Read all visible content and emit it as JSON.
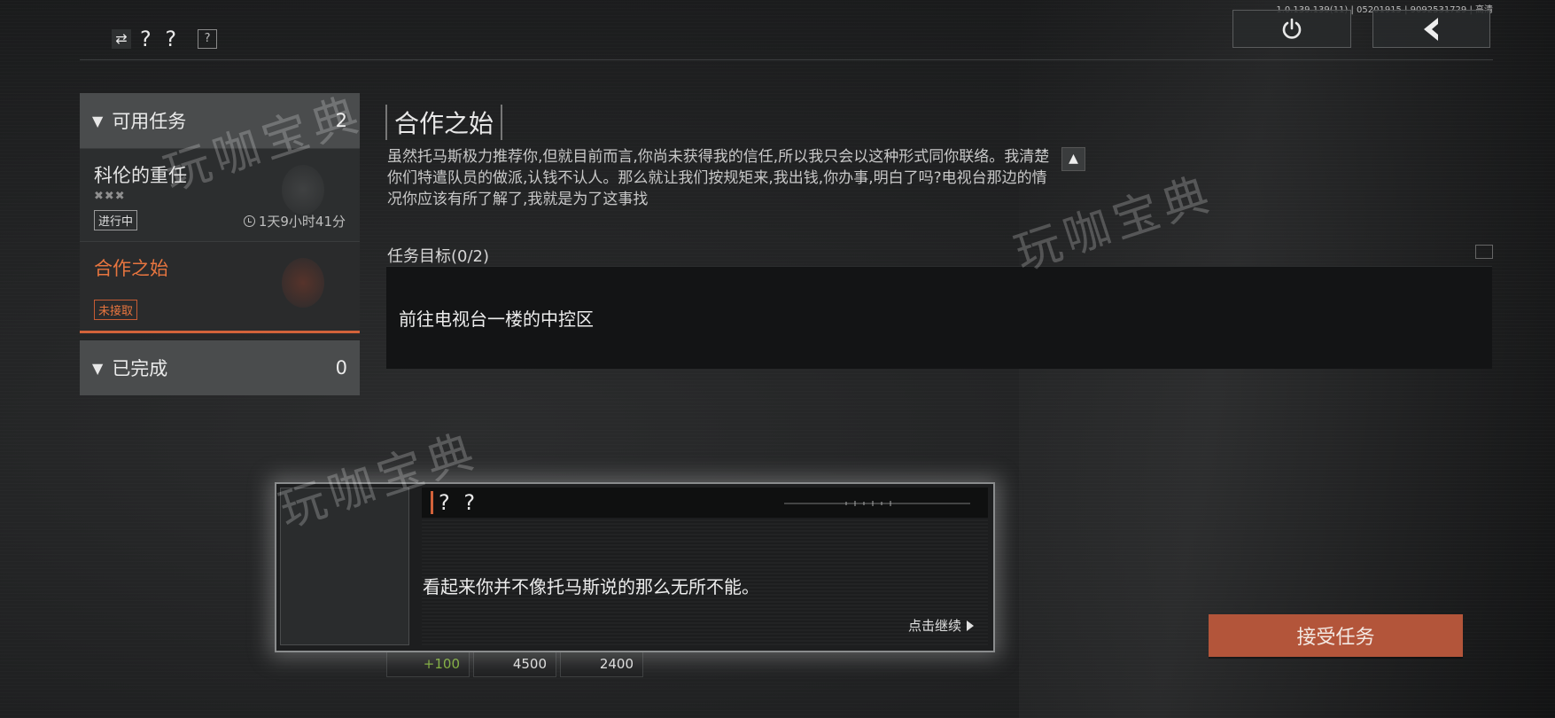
{
  "build_info": "1.0.139.139(11) | 05201915 | 9092531729 | 高清",
  "caller": {
    "name": "? ?",
    "swap_icon": "swap-arrows-icon",
    "help_label": "?"
  },
  "top_buttons": {
    "power_icon": "power-icon",
    "back_icon": "back-arrow-icon"
  },
  "sections": {
    "available": {
      "label": "可用任务",
      "count": "2"
    },
    "completed": {
      "label": "已完成",
      "count": "0"
    }
  },
  "quests": [
    {
      "title": "科伦的重任",
      "status": "进行中",
      "time": "1天9小时41分"
    },
    {
      "title": "合作之始",
      "status": "未接取"
    }
  ],
  "detail": {
    "title": "合作之始",
    "description": "虽然托马斯极力推荐你,但就目前而言,你尚未获得我的信任,所以我只会以这种形式同你联络。我清楚你们特遣队员的做派,认钱不认人。那么就让我们按规矩来,我出钱,你办事,明白了吗?电视台那边的情况你应该有所了解了,我就是为了这事找",
    "objective_label": "任务目标(0/2)",
    "objective": "前往电视台一楼的中控区"
  },
  "rewards": {
    "xp": "+100",
    "value1": "4500",
    "value2": "2400"
  },
  "accept_label": "接受任务",
  "dialogue": {
    "speaker": "? ?",
    "text": "看起来你并不像托马斯说的那么无所不能。",
    "continue": "点击继续"
  },
  "watermark": "玩咖宝典",
  "colors": {
    "accent": "#d2623a",
    "button": "#b3553a",
    "xp": "#7fae3a"
  }
}
